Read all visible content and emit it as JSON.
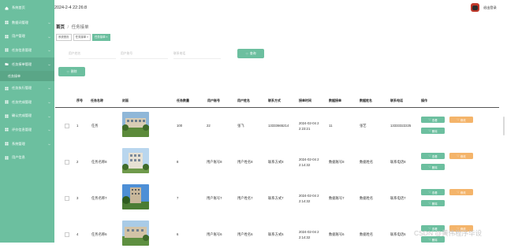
{
  "sidebar": {
    "items": [
      {
        "label": "系统首页",
        "icon": "home-icon",
        "chevron": false
      },
      {
        "label": "数据词管理",
        "icon": "grid-icon",
        "chevron": true
      },
      {
        "label": "用户管理",
        "icon": "grid-icon",
        "chevron": true
      },
      {
        "label": "任务信息管理",
        "icon": "grid-icon",
        "chevron": true
      },
      {
        "label": "任务接单管理",
        "icon": "folder-icon",
        "chevron": true,
        "active": true
      },
      {
        "label": "任务执行管理",
        "icon": "grid-icon",
        "chevron": true
      },
      {
        "label": "任务完成管理",
        "icon": "grid-icon",
        "chevron": true
      },
      {
        "label": "确认完成管理",
        "icon": "grid-icon",
        "chevron": true
      },
      {
        "label": "评价信息管理",
        "icon": "grid-icon",
        "chevron": true
      },
      {
        "label": "系统管理",
        "icon": "grid-icon",
        "chevron": true
      },
      {
        "label": "用户信息",
        "icon": "grid-icon",
        "chevron": false
      }
    ],
    "sub_item": "任务接单"
  },
  "topbar": {
    "date": "2024-2-4 22:26:8",
    "logout": "退出登录"
  },
  "breadcrumb": {
    "home": "首页",
    "sep": "/",
    "current": "任务接单"
  },
  "tabs": [
    "系统首页",
    "任务接单 ×",
    "任务接单 ×"
  ],
  "search": {
    "fields": [
      "用户姓名",
      "用户账号",
      "联系电话"
    ],
    "query_label": "查询",
    "delete_label": "删除"
  },
  "table": {
    "headers": [
      "序号",
      "任务名称",
      "封面",
      "任务数量",
      "用户账号",
      "用户姓名",
      "联系方式",
      "接单时间",
      "数据接单",
      "数据姓名",
      "联系电话",
      "操作"
    ],
    "rows": [
      {
        "no": "1",
        "name": "任务",
        "qty": "100",
        "acct": "22",
        "uname": "张飞",
        "contact": "13333665214",
        "time": [
          "2024-02-04 2",
          "2:23:21"
        ],
        "a": "11",
        "b": "张艺",
        "phone": "13333322225"
      },
      {
        "no": "2",
        "name": "任务名称8",
        "qty": "8",
        "acct": "用户账号8",
        "uname": "用户姓名8",
        "contact": "联系方式8",
        "time": [
          "2024-02-04 2",
          "2:14:32"
        ],
        "a": "数据账号8",
        "b": "数据姓名",
        "phone": "联系电话8"
      },
      {
        "no": "3",
        "name": "任务名称7",
        "qty": "7",
        "acct": "用户账号7",
        "uname": "用户姓名7",
        "contact": "联系方式7",
        "time": [
          "2024-02-04 2",
          "2:14:32"
        ],
        "a": "数据账号7",
        "b": "数据姓名",
        "phone": "联系电话7"
      },
      {
        "no": "4",
        "name": "任务名称6",
        "qty": "6",
        "acct": "用户账号6",
        "uname": "用户姓名6",
        "contact": "联系方式6",
        "time": [
          "2024-02-04 2",
          "2:14:32"
        ],
        "a": "数据账号6",
        "b": "数据姓名",
        "phone": "联系电话6"
      }
    ],
    "actions": {
      "view": "查看",
      "edit": "修改",
      "delete": "删除"
    }
  },
  "watermark": "CSDN @黄伟程序毕设",
  "colors": {
    "accent": "#6cbf9f",
    "sidebar": "#6cbf9f",
    "warning": "#f4b46a"
  }
}
